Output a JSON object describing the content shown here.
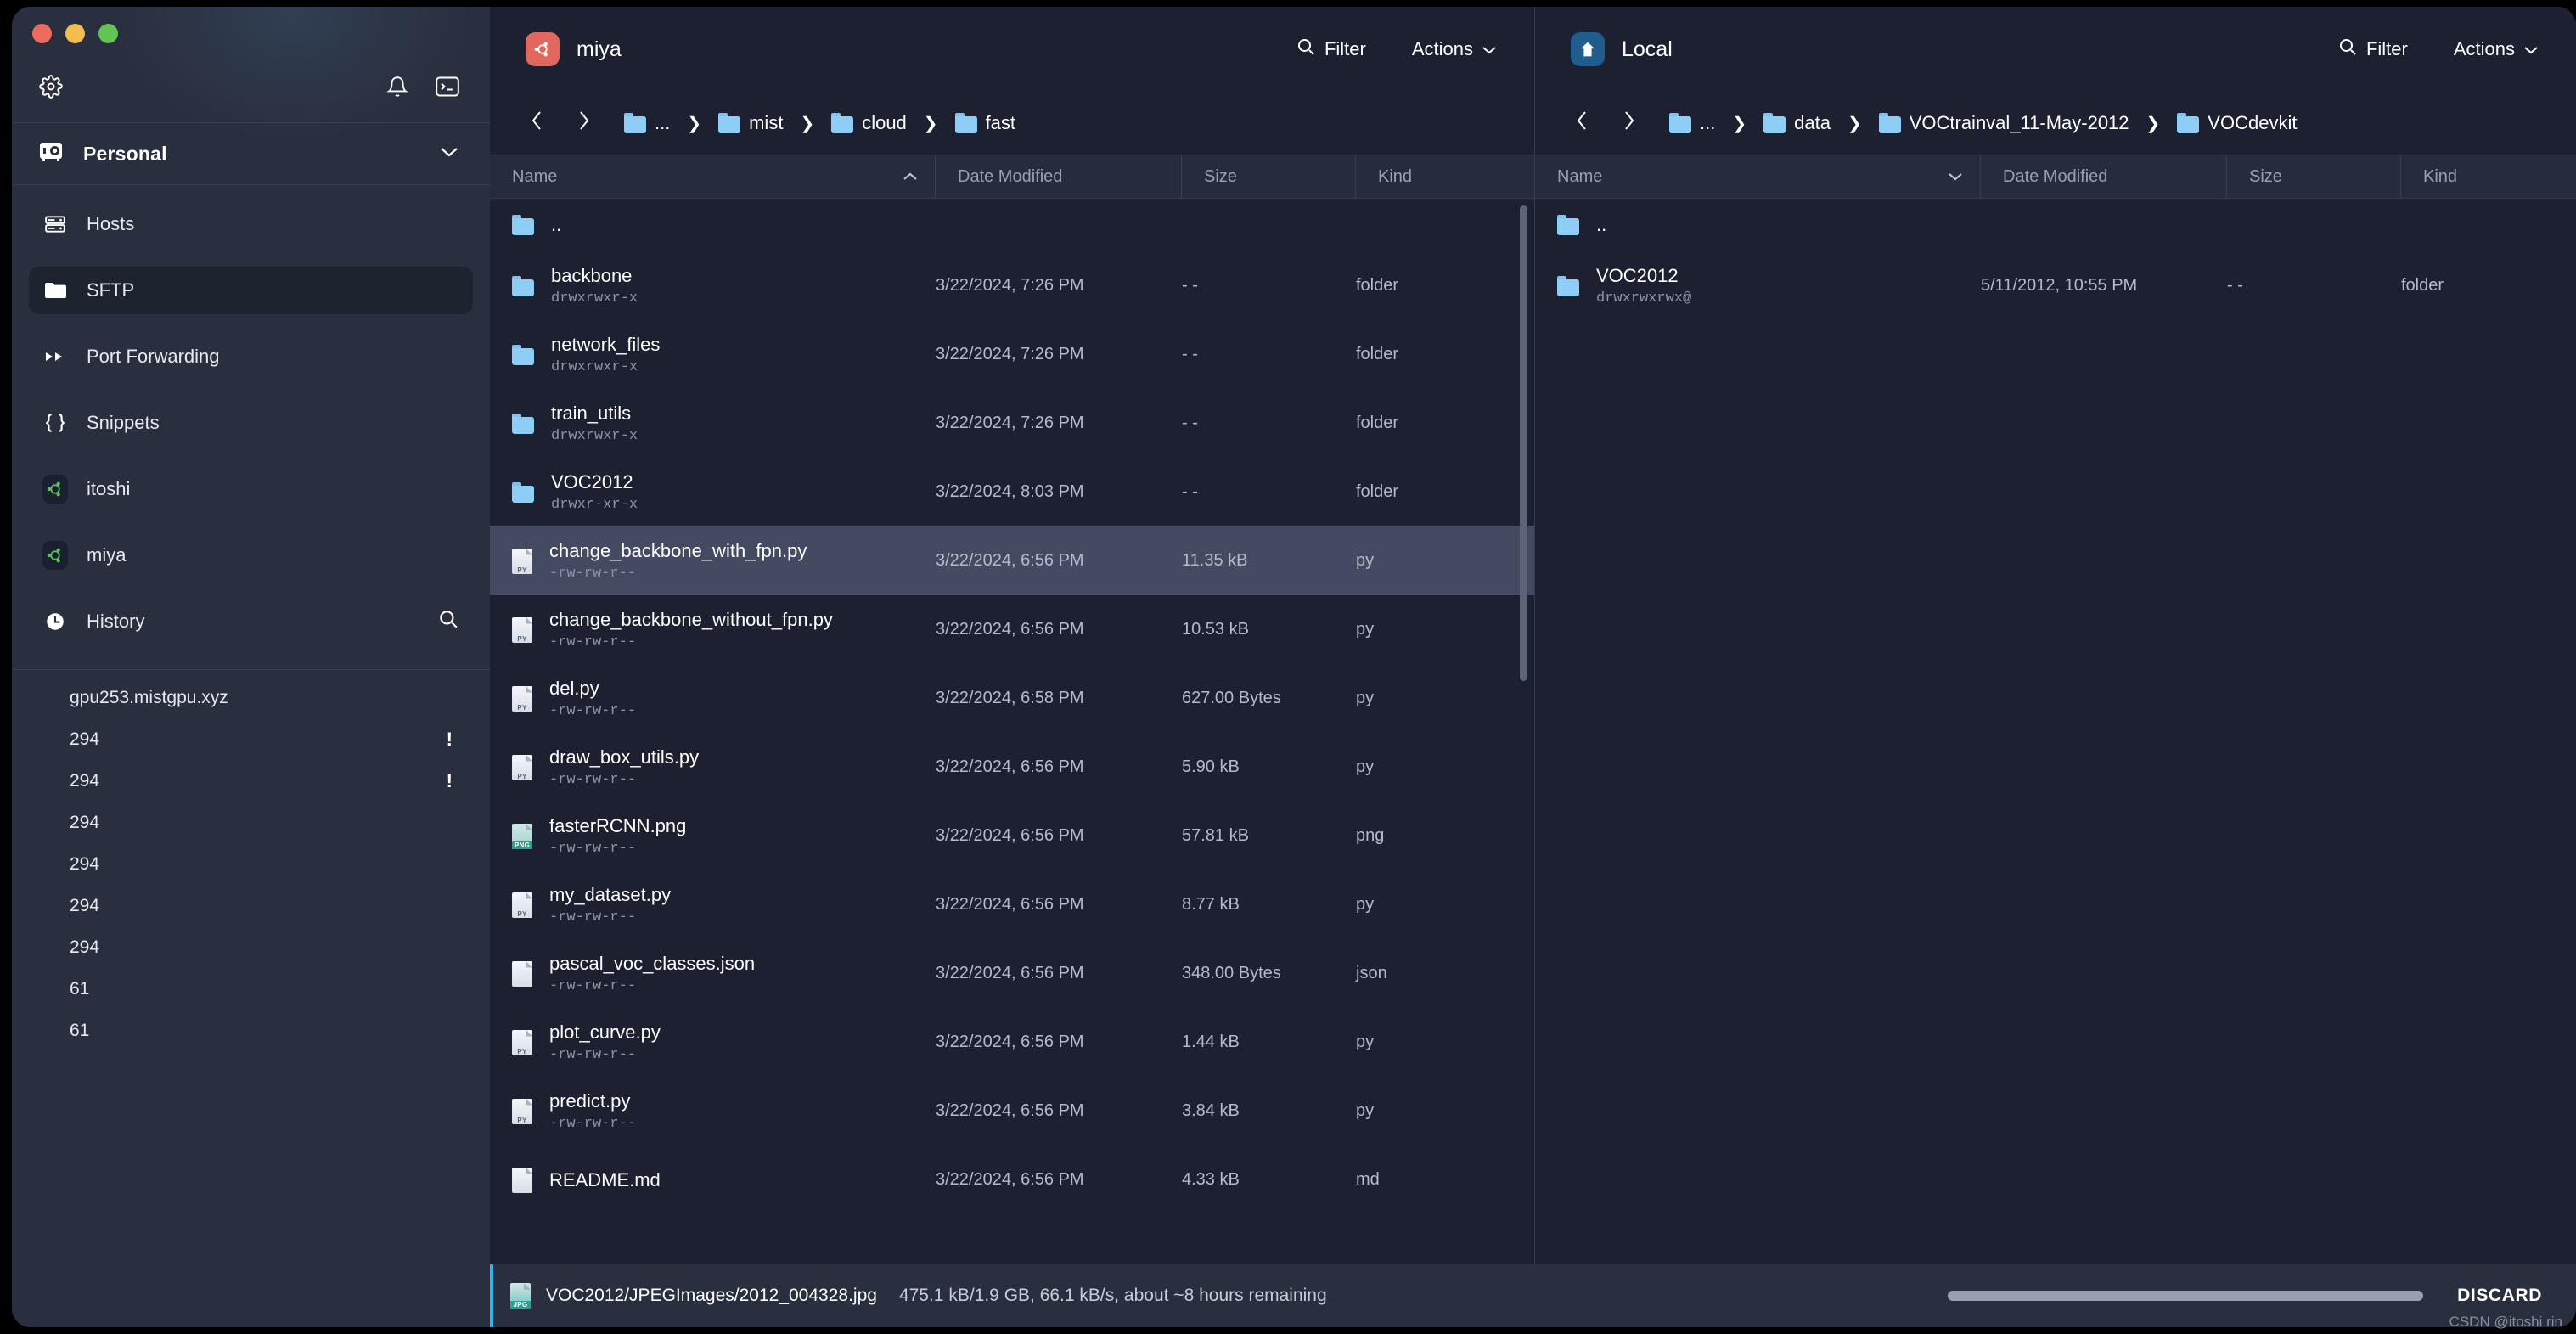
{
  "window": {
    "traffic_lights": [
      "close",
      "minimize",
      "maximize"
    ]
  },
  "sidebar": {
    "toolbar": {
      "settings_icon": "gear-icon",
      "notifications_icon": "bell-icon",
      "terminal_icon": "terminal-icon"
    },
    "vault": {
      "label": "Personal",
      "icon": "vault-icon",
      "chevron": "chevron-down-icon"
    },
    "nav_items": [
      {
        "label": "Hosts",
        "icon": "server-icon",
        "active": false
      },
      {
        "label": "SFTP",
        "icon": "folder-icon",
        "active": true
      },
      {
        "label": "Port Forwarding",
        "icon": "port-forward-icon",
        "active": false
      },
      {
        "label": "Snippets",
        "icon": "braces-icon",
        "active": false
      },
      {
        "label": "itoshi",
        "icon": "ubuntu-icon",
        "active": false
      },
      {
        "label": "miya",
        "icon": "ubuntu-icon",
        "active": false
      }
    ],
    "history": {
      "label": "History",
      "icon": "clock-icon",
      "search_icon": "search-icon",
      "items": [
        {
          "label": "gpu253.mistgpu.xyz",
          "badge": ""
        },
        {
          "label": "294",
          "badge": "!"
        },
        {
          "label": "294",
          "badge": "!"
        },
        {
          "label": "294",
          "badge": ""
        },
        {
          "label": "294",
          "badge": ""
        },
        {
          "label": "294",
          "badge": ""
        },
        {
          "label": "294",
          "badge": ""
        },
        {
          "label": "61",
          "badge": ""
        },
        {
          "label": "61",
          "badge": ""
        }
      ]
    }
  },
  "panels": [
    {
      "id": "remote",
      "title": "miya",
      "avatar_icon": "ubuntu-icon",
      "avatar_color": "#e2685f",
      "filter_label": "Filter",
      "filter_icon": "search-icon",
      "actions_label": "Actions",
      "actions_chevron": "chevron-down-icon",
      "nav_back_icon": "chevron-left-icon",
      "nav_forward_icon": "chevron-right-icon",
      "breadcrumbs": [
        "...",
        "mist",
        "cloud",
        "fast"
      ],
      "columns": {
        "name": "Name",
        "date": "Date Modified",
        "size": "Size",
        "kind": "Kind",
        "sort_indicator": "chevron-up-icon"
      },
      "rows": [
        {
          "name": "..",
          "perm": "",
          "date": "",
          "size": "",
          "kind": "",
          "icon": "folder",
          "selected": false,
          "updir": true
        },
        {
          "name": "backbone",
          "perm": "drwxrwxr-x",
          "date": "3/22/2024, 7:26 PM",
          "size": "- -",
          "kind": "folder",
          "icon": "folder",
          "selected": false
        },
        {
          "name": "network_files",
          "perm": "drwxrwxr-x",
          "date": "3/22/2024, 7:26 PM",
          "size": "- -",
          "kind": "folder",
          "icon": "folder",
          "selected": false
        },
        {
          "name": "train_utils",
          "perm": "drwxrwxr-x",
          "date": "3/22/2024, 7:26 PM",
          "size": "- -",
          "kind": "folder",
          "icon": "folder",
          "selected": false
        },
        {
          "name": "VOC2012",
          "perm": "drwxr-xr-x",
          "date": "3/22/2024, 8:03 PM",
          "size": "- -",
          "kind": "folder",
          "icon": "folder",
          "selected": false
        },
        {
          "name": "change_backbone_with_fpn.py",
          "perm": "-rw-rw-r--",
          "date": "3/22/2024, 6:56 PM",
          "size": "11.35 kB",
          "kind": "py",
          "icon": "py",
          "selected": true
        },
        {
          "name": "change_backbone_without_fpn.py",
          "perm": "-rw-rw-r--",
          "date": "3/22/2024, 6:56 PM",
          "size": "10.53 kB",
          "kind": "py",
          "icon": "py",
          "selected": false
        },
        {
          "name": "del.py",
          "perm": "-rw-rw-r--",
          "date": "3/22/2024, 6:58 PM",
          "size": "627.00 Bytes",
          "kind": "py",
          "icon": "py",
          "selected": false
        },
        {
          "name": "draw_box_utils.py",
          "perm": "-rw-rw-r--",
          "date": "3/22/2024, 6:56 PM",
          "size": "5.90 kB",
          "kind": "py",
          "icon": "py",
          "selected": false
        },
        {
          "name": "fasterRCNN.png",
          "perm": "-rw-rw-r--",
          "date": "3/22/2024, 6:56 PM",
          "size": "57.81 kB",
          "kind": "png",
          "icon": "png",
          "selected": false
        },
        {
          "name": "my_dataset.py",
          "perm": "-rw-rw-r--",
          "date": "3/22/2024, 6:56 PM",
          "size": "8.77 kB",
          "kind": "py",
          "icon": "py",
          "selected": false
        },
        {
          "name": "pascal_voc_classes.json",
          "perm": "-rw-rw-r--",
          "date": "3/22/2024, 6:56 PM",
          "size": "348.00 Bytes",
          "kind": "json",
          "icon": "doc",
          "selected": false
        },
        {
          "name": "plot_curve.py",
          "perm": "-rw-rw-r--",
          "date": "3/22/2024, 6:56 PM",
          "size": "1.44 kB",
          "kind": "py",
          "icon": "py",
          "selected": false
        },
        {
          "name": "predict.py",
          "perm": "-rw-rw-r--",
          "date": "3/22/2024, 6:56 PM",
          "size": "3.84 kB",
          "kind": "py",
          "icon": "py",
          "selected": false
        },
        {
          "name": "README.md",
          "perm": "",
          "date": "3/22/2024, 6:56 PM",
          "size": "4.33 kB",
          "kind": "md",
          "icon": "doc",
          "selected": false
        }
      ]
    },
    {
      "id": "local",
      "title": "Local",
      "avatar_icon": "home-icon",
      "avatar_color": "#1e5d8e",
      "filter_label": "Filter",
      "filter_icon": "search-icon",
      "actions_label": "Actions",
      "actions_chevron": "chevron-down-icon",
      "nav_back_icon": "chevron-left-icon",
      "nav_forward_icon": "chevron-right-icon",
      "breadcrumbs": [
        "...",
        "data",
        "VOCtrainval_11-May-2012",
        "VOCdevkit"
      ],
      "columns": {
        "name": "Name",
        "date": "Date Modified",
        "size": "Size",
        "kind": "Kind",
        "sort_indicator": "chevron-down-icon"
      },
      "rows": [
        {
          "name": "..",
          "perm": "",
          "date": "",
          "size": "",
          "kind": "",
          "icon": "folder",
          "selected": false,
          "updir": true
        },
        {
          "name": "VOC2012",
          "perm": "drwxrwxrwx@",
          "date": "5/11/2012, 10:55 PM",
          "size": "- -",
          "kind": "folder",
          "icon": "folder",
          "selected": false
        }
      ]
    }
  ],
  "transfer": {
    "file_icon": "jpg-file-icon",
    "file_path": "VOC2012/JPEGImages/2012_004328.jpg",
    "status": "475.1 kB/1.9 GB, 66.1 kB/s, about ~8 hours remaining",
    "progress_percent": 0,
    "discard_label": "DISCARD",
    "accent_color": "#34b3ea"
  },
  "watermark": "CSDN @itoshi rin"
}
